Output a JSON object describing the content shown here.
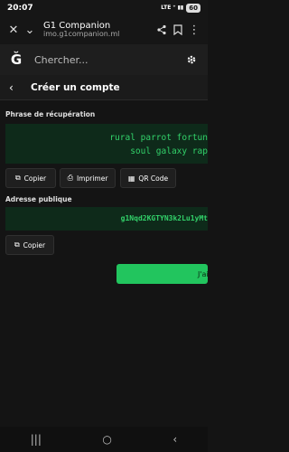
{
  "status_bar": {
    "time": "20:07",
    "sys": "LTE ⁺ ▮▮",
    "battery": "60"
  },
  "browser": {
    "title": "Ğ1 Companion",
    "url": "imo.g1companion.ml",
    "icons": [
      "close-icon",
      "chevron-down-icon",
      "share-icon",
      "bookmark-icon",
      "more-icon"
    ]
  },
  "header": {
    "search_placeholder": "Chercher...",
    "logo": "Ğ"
  },
  "page": {
    "title": "Créer un compte",
    "back": "‹"
  },
  "recovery": {
    "label": "Phrase de récupération",
    "line1": "rural parrot fortun",
    "line2": "soul galaxy rap",
    "buttons": {
      "copy": "Copier",
      "print": "Imprimer",
      "qr": "QR Code"
    }
  },
  "address": {
    "label": "Adresse publique",
    "value": "g1Nqd2KGTYN3k2Lu1yMt",
    "copy": "Copier"
  },
  "primary_button": "J'ai",
  "nav": [
    "|||",
    "○",
    "‹"
  ]
}
